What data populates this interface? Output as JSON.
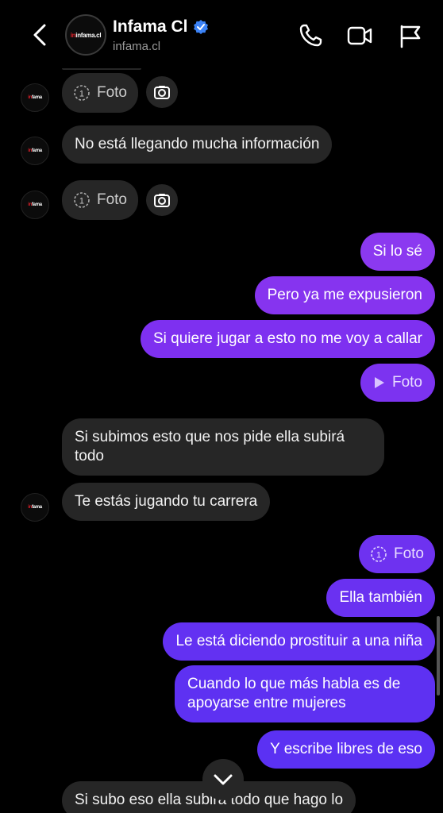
{
  "header": {
    "name": "Infama Cl",
    "handle": "infama.cl",
    "logo": "infama.cl",
    "icons": [
      "back-chevron-icon",
      "verified-badge-icon",
      "phone-icon",
      "video-camera-icon",
      "flag-icon"
    ]
  },
  "messages": {
    "m1": "Foto",
    "m2": "No está llegando mucha información",
    "m3": "Foto",
    "m4": "Si lo sé",
    "m5": "Pero ya me expusieron",
    "m6": "Si quiere jugar a esto no me voy a callar",
    "m7": "Foto",
    "m8": "Si subimos esto que nos pide ella subirá todo",
    "m9": "Te estás jugando tu carrera",
    "m10": "Foto",
    "m11": "Ella también",
    "m12": "Le está diciendo prostituir a una niña",
    "m13": "Cuando lo que más habla es de apoyarse entre mujeres",
    "m14": "Y escribe libres de eso",
    "m15": "Si subo eso ella subira todo que hago lo"
  },
  "colors": {
    "background": "#000000",
    "incoming": "#262626",
    "outgoing": "#7b2ff0",
    "verified": "#3b82f6"
  }
}
